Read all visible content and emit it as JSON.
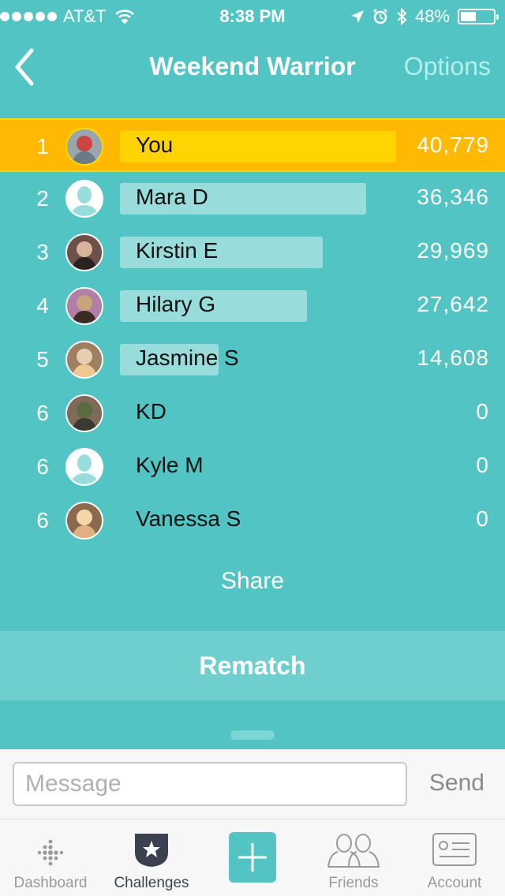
{
  "status_bar": {
    "carrier": "AT&T",
    "time": "8:38 PM",
    "battery_percent": "48%",
    "battery_level": 0.48
  },
  "header": {
    "back_icon": "chevron-left-icon",
    "title": "Weekend Warrior",
    "options_label": "Options"
  },
  "leaderboard": [
    {
      "rank": "1",
      "name": "You",
      "score": "40,779",
      "steps": 40779,
      "highlight": true,
      "avatar": "photo"
    },
    {
      "rank": "2",
      "name": "Mara D",
      "score": "36,346",
      "steps": 36346,
      "highlight": false,
      "avatar": "placeholder"
    },
    {
      "rank": "3",
      "name": "Kirstin E",
      "score": "29,969",
      "steps": 29969,
      "highlight": false,
      "avatar": "photo"
    },
    {
      "rank": "4",
      "name": "Hilary G",
      "score": "27,642",
      "steps": 27642,
      "highlight": false,
      "avatar": "photo"
    },
    {
      "rank": "5",
      "name": "Jasmine S",
      "score": "14,608",
      "steps": 14608,
      "highlight": false,
      "avatar": "photo"
    },
    {
      "rank": "6",
      "name": "KD",
      "score": "0",
      "steps": 0,
      "highlight": false,
      "avatar": "photo"
    },
    {
      "rank": "6",
      "name": "Kyle M",
      "score": "0",
      "steps": 0,
      "highlight": false,
      "avatar": "placeholder"
    },
    {
      "rank": "6",
      "name": "Vanessa S",
      "score": "0",
      "steps": 0,
      "highlight": false,
      "avatar": "photo"
    }
  ],
  "actions": {
    "share_label": "Share",
    "rematch_label": "Rematch"
  },
  "message": {
    "placeholder": "Message",
    "send_label": "Send"
  },
  "tabs": [
    {
      "label": "Dashboard",
      "icon": "dots-logo-icon",
      "active": false
    },
    {
      "label": "Challenges",
      "icon": "star-badge-icon",
      "active": true
    },
    {
      "label": "",
      "icon": "plus-icon",
      "active": false
    },
    {
      "label": "Friends",
      "icon": "friends-icon",
      "active": false
    },
    {
      "label": "Account",
      "icon": "id-card-icon",
      "active": false
    }
  ],
  "colors": {
    "background": "#52c4c4",
    "highlight": "#ffb900",
    "highlight_bar": "#ffd400",
    "bar": "#98dddc"
  }
}
